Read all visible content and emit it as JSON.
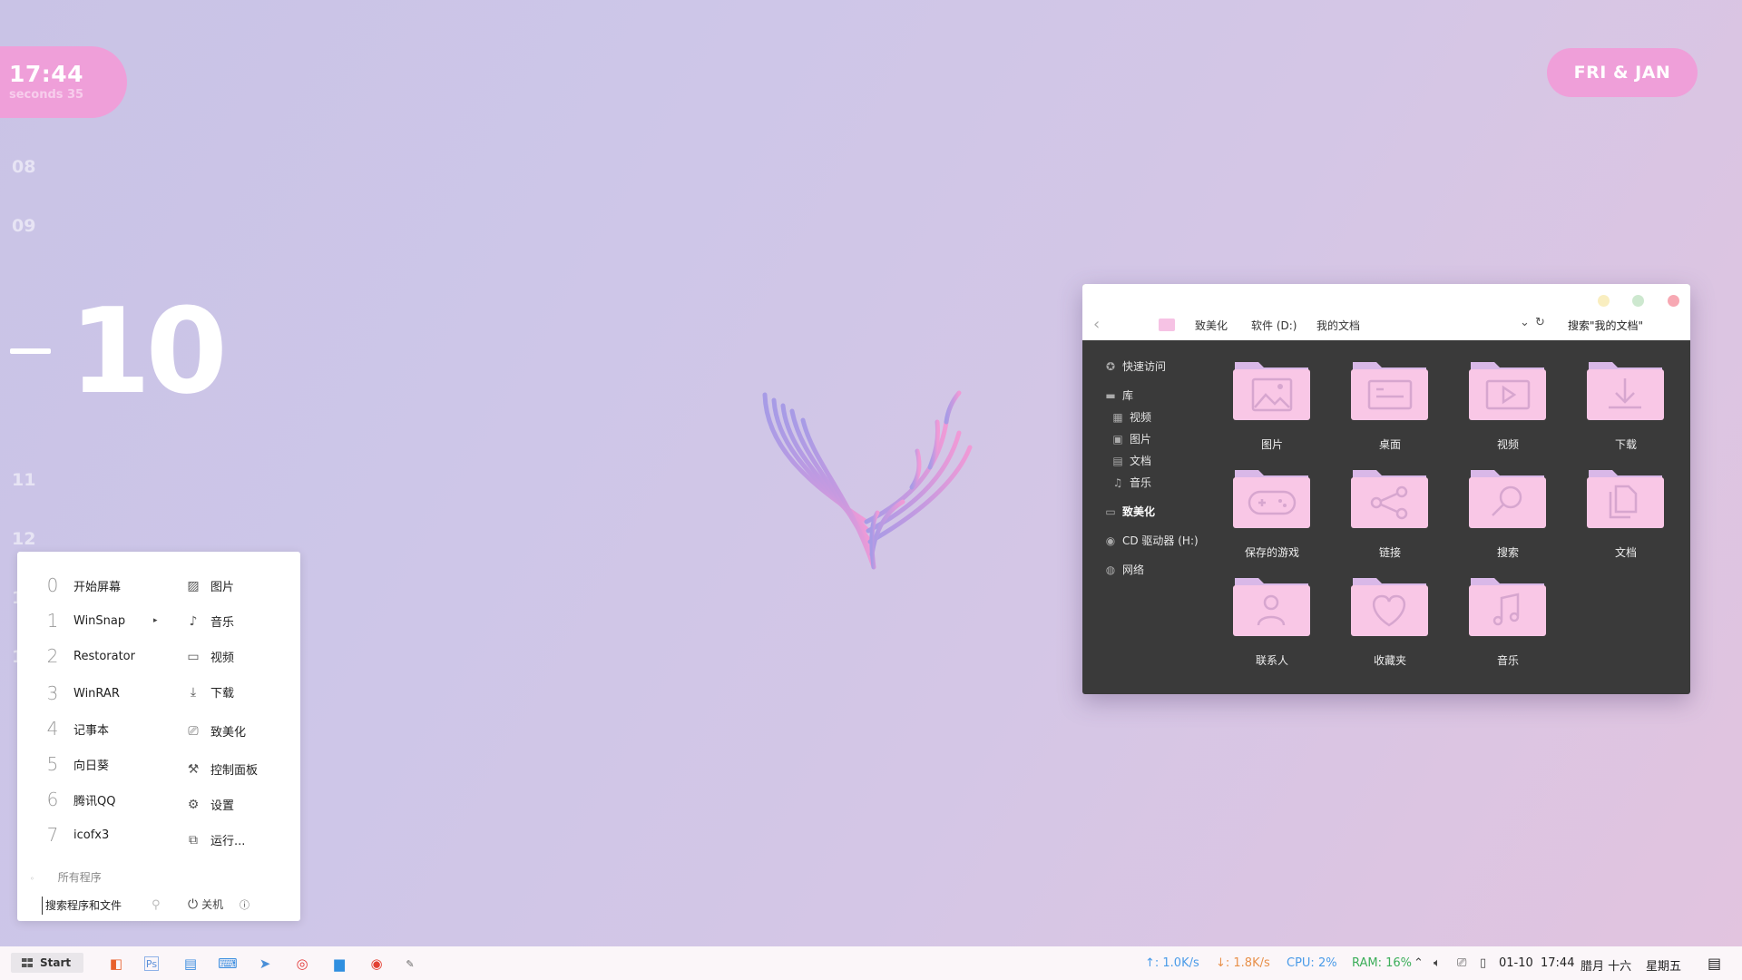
{
  "clock": {
    "time": "17:44",
    "seconds": "seconds 35",
    "day_month": "FRI & JAN"
  },
  "date_scroller": {
    "before": [
      "08",
      "09"
    ],
    "current": "10",
    "after": [
      "11",
      "12",
      "1",
      "1"
    ]
  },
  "explorer": {
    "breadcrumb": [
      "致美化",
      "软件 (D:)",
      "我的文档"
    ],
    "search_placeholder": "搜索\"我的文档\"",
    "nav": {
      "quick_access": "快速访问",
      "library": "库",
      "library_items": [
        "视频",
        "图片",
        "文档",
        "音乐"
      ],
      "pc": "致美化",
      "cd_drive": "CD 驱动器 (H:)",
      "network": "网络"
    },
    "folders": [
      {
        "label": "图片",
        "icon": "image-icon"
      },
      {
        "label": "桌面",
        "icon": "desktop-icon"
      },
      {
        "label": "视频",
        "icon": "video-icon"
      },
      {
        "label": "下载",
        "icon": "download-icon"
      },
      {
        "label": "保存的游戏",
        "icon": "gamepad-icon"
      },
      {
        "label": "链接",
        "icon": "share-icon"
      },
      {
        "label": "搜索",
        "icon": "search-icon"
      },
      {
        "label": "文档",
        "icon": "documents-icon"
      },
      {
        "label": "联系人",
        "icon": "contact-icon"
      },
      {
        "label": "收藏夹",
        "icon": "heart-icon"
      },
      {
        "label": "音乐",
        "icon": "music-icon"
      }
    ],
    "window_colors": {
      "minimize": "#f9eec0",
      "maximize": "#cde8cf",
      "close": "#f7a8b3"
    }
  },
  "start_menu": {
    "programs": [
      {
        "num": "0",
        "label": "开始屏幕"
      },
      {
        "num": "1",
        "label": "WinSnap"
      },
      {
        "num": "2",
        "label": "Restorator"
      },
      {
        "num": "3",
        "label": "WinRAR"
      },
      {
        "num": "4",
        "label": "记事本"
      },
      {
        "num": "5",
        "label": "向日葵"
      },
      {
        "num": "6",
        "label": "腾讯QQ"
      },
      {
        "num": "7",
        "label": "icofx3"
      }
    ],
    "places": [
      {
        "label": "图片",
        "icon": "image-icon"
      },
      {
        "label": "音乐",
        "icon": "music-note-icon"
      },
      {
        "label": "视频",
        "icon": "video-icon"
      },
      {
        "label": "下载",
        "icon": "download-icon"
      },
      {
        "label": "致美化",
        "icon": "computer-icon"
      },
      {
        "label": "控制面板",
        "icon": "wrench-icon"
      },
      {
        "label": "设置",
        "icon": "gear-icon"
      },
      {
        "label": "运行...",
        "icon": "run-icon"
      }
    ],
    "all_programs": "所有程序",
    "search_placeholder": "搜索程序和文件",
    "shutdown": "关机"
  },
  "taskbar": {
    "start_label": "Start",
    "apps": [
      "office-icon",
      "photoshop-icon",
      "notepad-icon",
      "terminal-icon",
      "telegram-icon",
      "netease-music-icon",
      "file-explorer-icon",
      "chrome-icon",
      "pen-icon"
    ],
    "upload": "↑: 1.0K/s",
    "download": "↓: 1.8K/s",
    "cpu": "CPU: 2%",
    "ram": "RAM: 16%",
    "date": "01-10",
    "time": "17:44",
    "lunar": "腊月 十六",
    "weekday": "星期五",
    "colors": {
      "upload": "#4a9be8",
      "download": "#e8904a",
      "cpu": "#4a9be8",
      "ram": "#3cae5a"
    }
  }
}
